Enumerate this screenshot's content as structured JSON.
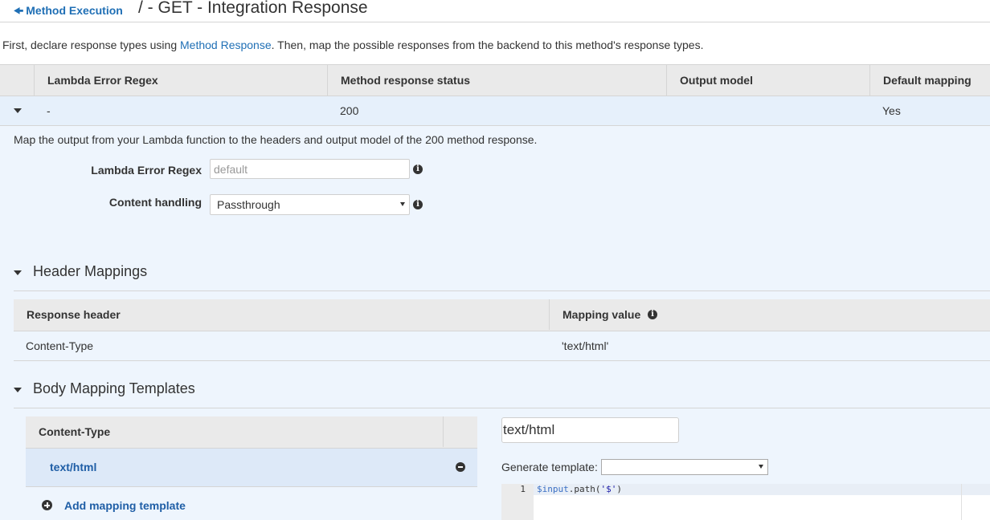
{
  "header": {
    "back_label": "Method Execution",
    "title": "/ - GET - Integration Response"
  },
  "intro": {
    "before": "First, declare response types using ",
    "link": "Method Response",
    "after": ". Then, map the possible responses from the backend to this method's response types."
  },
  "responses_table": {
    "columns": [
      "Lambda Error Regex",
      "Method response status",
      "Output model",
      "Default mapping"
    ],
    "rows": [
      {
        "regex": "-",
        "status": "200",
        "model": "",
        "default": "Yes"
      }
    ]
  },
  "panel": {
    "description": "Map the output from your Lambda function to the headers and output model of the 200 method response.",
    "regex_label": "Lambda Error Regex",
    "regex_placeholder": "default",
    "content_handling_label": "Content handling",
    "content_handling_value": "Passthrough"
  },
  "header_mappings": {
    "title": "Header Mappings",
    "columns": [
      "Response header",
      "Mapping value"
    ],
    "rows": [
      {
        "header": "Content-Type",
        "value": "'text/html'"
      }
    ]
  },
  "body_templates": {
    "title": "Body Mapping Templates",
    "column": "Content-Type",
    "items": [
      "text/html"
    ],
    "add_label": "Add mapping template",
    "content_type_input": "text/html",
    "generate_label": "Generate template:",
    "generate_value": "",
    "editor": {
      "line_number": "1",
      "code_var": "$input",
      "code_mid": ".path(",
      "code_str": "'$'",
      "code_end": ")"
    }
  },
  "colors": {
    "link": "#1f6fb5",
    "selected_row": "#e6f0fb",
    "panel_bg": "#eef5fd",
    "table_header": "#eaeaea"
  }
}
